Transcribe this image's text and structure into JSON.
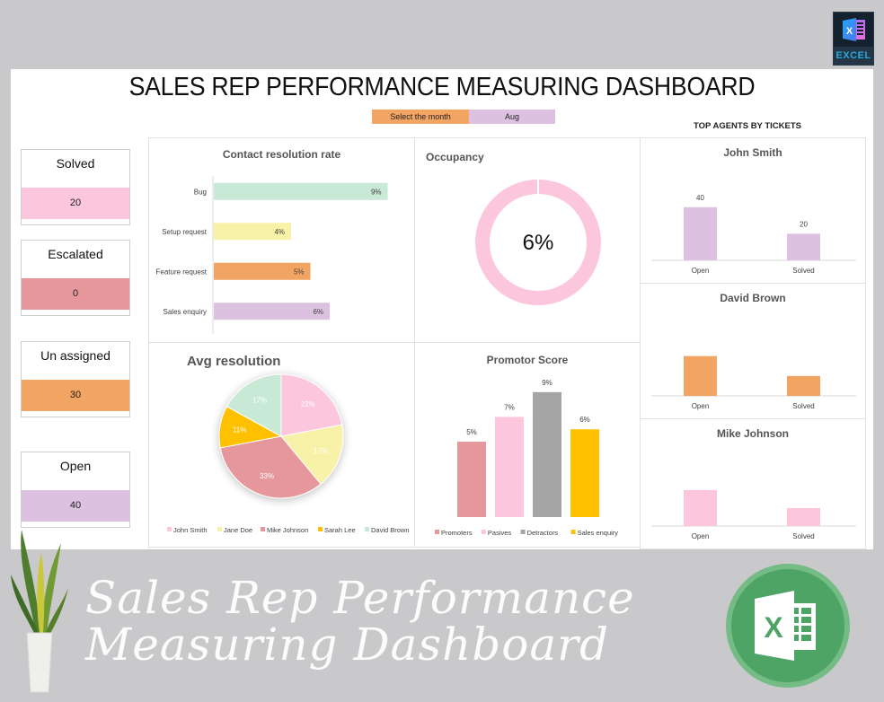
{
  "brand_badge": {
    "label": "EXCEL",
    "icon": "excel-icon"
  },
  "title": "SALES REP PERFORMANCE MEASURING DASHBOARD",
  "month_selector": {
    "label": "Select the month",
    "value": "Aug"
  },
  "kpis": [
    {
      "label": "Solved",
      "value": "20",
      "color": "#fcc6dc"
    },
    {
      "label": "Escalated",
      "value": "0",
      "color": "#e6979c"
    },
    {
      "label": "Un assigned",
      "value": "30",
      "color": "#f2a462"
    },
    {
      "label": "Open",
      "value": "40",
      "color": "#dcc2e0"
    }
  ],
  "top_agents_title": "TOP AGENTS BY TICKETS",
  "footer": {
    "line1": "Sales Rep Performance",
    "line2": "Measuring Dashboard",
    "logo_icon": "excel-logo-icon",
    "decor_icon": "plant-icon"
  },
  "chart_data": [
    {
      "id": "contact_resolution",
      "type": "bar",
      "orientation": "horizontal",
      "title": "Contact resolution rate",
      "categories": [
        "Bug",
        "Setup request",
        "Feature request",
        "Sales enquiry"
      ],
      "values": [
        9,
        4,
        5,
        6
      ],
      "labels": [
        "9%",
        "4%",
        "5%",
        "6%"
      ],
      "colors": [
        "#c9e9d7",
        "#f8f1a8",
        "#f2a462",
        "#dcc2e0"
      ],
      "xlim": [
        0,
        10
      ],
      "grid": false
    },
    {
      "id": "occupancy",
      "type": "pie",
      "variant": "donut",
      "title": "Occupancy",
      "center_label": "6%",
      "values": [
        100
      ],
      "colors": [
        "#fcc6dc"
      ]
    },
    {
      "id": "avg_resolution",
      "type": "pie",
      "title": "Avg resolution",
      "categories": [
        "John Smith",
        "Jane Doe",
        "Mike Johnson",
        "Sarah Lee",
        "David Brown"
      ],
      "values": [
        22,
        17,
        33,
        11,
        17
      ],
      "labels": [
        "22%",
        "17%",
        "33%",
        "11%",
        "17%"
      ],
      "colors": [
        "#fcc6dc",
        "#f8f1a8",
        "#e6979c",
        "#ffc000",
        "#c9e9d7"
      ],
      "legend": "bottom"
    },
    {
      "id": "promotor_score",
      "type": "bar",
      "title": "Promotor Score",
      "categories": [
        "Promoters",
        "Pasives",
        "Detractors",
        "Sales enquiry"
      ],
      "values": [
        5,
        7,
        9,
        6
      ],
      "labels": [
        "5%",
        "7%",
        "9%",
        "6%"
      ],
      "colors": [
        "#e6979c",
        "#fcc6dc",
        "#a5a5a5",
        "#ffc000"
      ],
      "ylim": [
        0,
        10
      ],
      "legend": "bottom"
    },
    {
      "id": "agent_john_smith",
      "type": "bar",
      "title": "John Smith",
      "categories": [
        "Open",
        "Solved"
      ],
      "values": [
        40,
        20
      ],
      "labels": [
        "40",
        "20"
      ],
      "color": "#dcc2e0",
      "ylim": [
        0,
        50
      ]
    },
    {
      "id": "agent_david_brown",
      "type": "bar",
      "title": "David Brown",
      "categories": [
        "Open",
        "Solved"
      ],
      "values": [
        40,
        20
      ],
      "labels": [
        "",
        ""
      ],
      "color": "#f2a462",
      "ylim": [
        0,
        50
      ]
    },
    {
      "id": "agent_mike_johnson",
      "type": "bar",
      "title": "Mike Johnson",
      "categories": [
        "Open",
        "Solved"
      ],
      "values": [
        40,
        20
      ],
      "labels": [
        "",
        ""
      ],
      "color": "#fcc6dc",
      "ylim": [
        0,
        50
      ]
    }
  ]
}
